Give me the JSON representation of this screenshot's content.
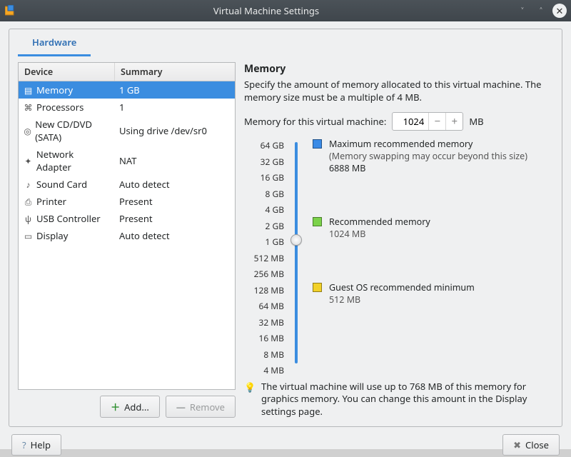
{
  "window": {
    "title": "Virtual Machine Settings"
  },
  "tabs": {
    "hardware": "Hardware"
  },
  "devtable": {
    "head_device": "Device",
    "head_summary": "Summary",
    "rows": [
      {
        "name": "Memory",
        "summary": "1 GB"
      },
      {
        "name": "Processors",
        "summary": "1"
      },
      {
        "name": "New CD/DVD (SATA)",
        "summary": "Using drive /dev/sr0"
      },
      {
        "name": "Network Adapter",
        "summary": "NAT"
      },
      {
        "name": "Sound Card",
        "summary": "Auto detect"
      },
      {
        "name": "Printer",
        "summary": "Present"
      },
      {
        "name": "USB Controller",
        "summary": "Present"
      },
      {
        "name": "Display",
        "summary": "Auto detect"
      }
    ]
  },
  "left_buttons": {
    "add": "Add...",
    "remove": "Remove"
  },
  "memory": {
    "title": "Memory",
    "desc": "Specify the amount of memory allocated to this virtual machine. The memory size must be a multiple of 4 MB.",
    "field_label": "Memory for this virtual machine:",
    "value": "1024",
    "unit": "MB",
    "ticks": [
      "64 GB",
      "32 GB",
      "16 GB",
      "8 GB",
      "4 GB",
      "2 GB",
      "1 GB",
      "512 MB",
      "256 MB",
      "128 MB",
      "64 MB",
      "32 MB",
      "16 MB",
      "8 MB",
      "4 MB"
    ],
    "max_label": "Maximum recommended memory",
    "max_sub": "(Memory swapping may occur beyond this size)",
    "max_val": "6888 MB",
    "rec_label": "Recommended memory",
    "rec_val": "1024 MB",
    "min_label": "Guest OS recommended minimum",
    "min_val": "512 MB",
    "note": "The virtual machine will use up to 768 MB of this memory for graphics memory. You can change this amount in the Display settings page."
  },
  "bottom": {
    "help": "Help",
    "close": "Close"
  }
}
